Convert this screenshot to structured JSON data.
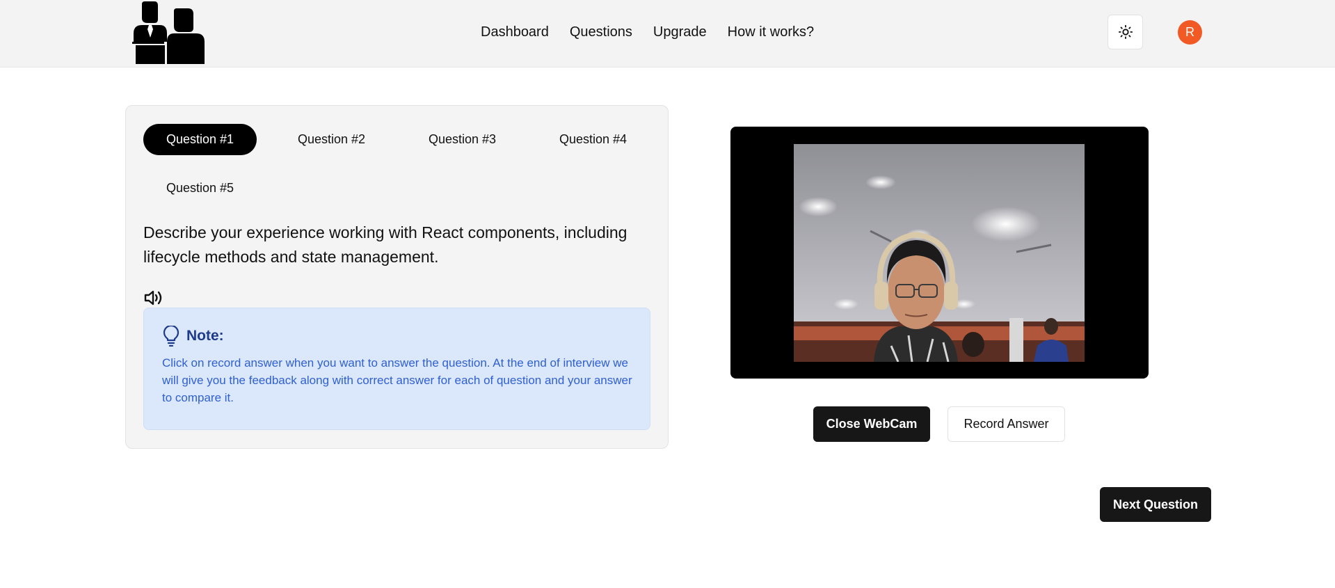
{
  "header": {
    "nav": [
      "Dashboard",
      "Questions",
      "Upgrade",
      "How it works?"
    ],
    "avatar_initial": "R"
  },
  "questions": {
    "tabs": [
      "Question #1",
      "Question #2",
      "Question #3",
      "Question #4",
      "Question #5"
    ],
    "active_index": 0,
    "current_text": "Describe your experience working with React components, including lifecycle methods and state management."
  },
  "note": {
    "title": "Note:",
    "body": "Click on record answer when you want to answer the question. At the end of interview we will give you the feedback along with correct answer for each of question and your answer to compare it."
  },
  "webcam": {
    "close_label": "Close WebCam",
    "record_label": "Record Answer"
  },
  "footer": {
    "next_label": "Next Question"
  },
  "colors": {
    "avatar": "#f15a24",
    "note_bg": "#dbe8fb",
    "note_title": "#1e3a8a",
    "note_text": "#2f5fd0"
  }
}
